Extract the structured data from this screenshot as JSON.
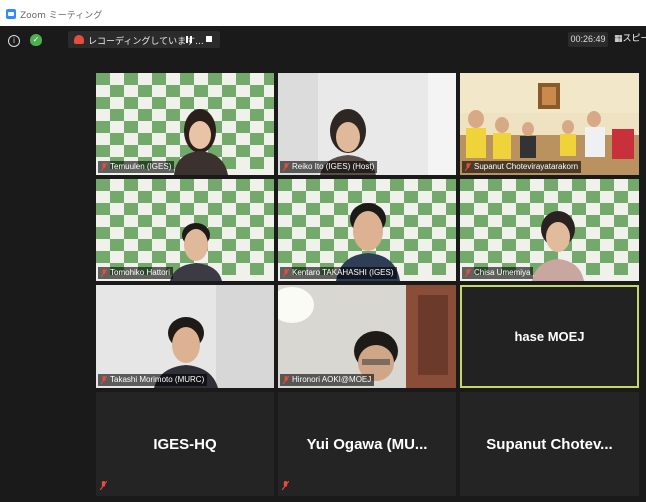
{
  "window": {
    "title": "Zoom ミーティング"
  },
  "topbar": {
    "recording_text": "レコーディングしています...",
    "timer": "00:26:49",
    "view_label": "スピー"
  },
  "colors": {
    "accent_active": "#c3d86b",
    "mute": "#e74c3c",
    "shield": "#4caf50"
  },
  "participants": [
    {
      "name": "Temuulen (IGES)",
      "video": true
    },
    {
      "name": "Reiko Ito (IGES) (Host)",
      "video": true
    },
    {
      "name": "Supanut Chotevirayatarakorn",
      "video": true
    },
    {
      "name": "Tomohiko Hattori",
      "video": true
    },
    {
      "name": "Kentaro TAKAHASHI (IGES)",
      "video": true
    },
    {
      "name": "Chisa Umemiya",
      "video": true
    },
    {
      "name": "Takashi Morimoto (MURC)",
      "video": true
    },
    {
      "name": "Hironori AOKI@MOEJ",
      "video": true
    },
    {
      "name": "hase MOEJ",
      "video": false,
      "active_speaker": true
    },
    {
      "name": "IGES-HQ",
      "video": false
    },
    {
      "name": "Yui Ogawa (MU...",
      "video": false
    },
    {
      "name": "Supanut Chotev...",
      "video": false
    }
  ]
}
